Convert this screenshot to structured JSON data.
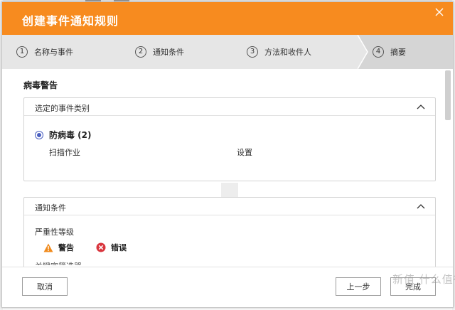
{
  "dialog": {
    "title": "创建事件通知规则"
  },
  "steps": [
    {
      "num": "1",
      "label": "名称与事件"
    },
    {
      "num": "2",
      "label": "通知条件"
    },
    {
      "num": "3",
      "label": "方法和收件人"
    },
    {
      "num": "4",
      "label": "摘要"
    }
  ],
  "summary": {
    "section_title": "病毒警告",
    "event_panel": {
      "header": "选定的事件类别",
      "selected_event": "防病毒 (2)",
      "items": [
        "扫描作业",
        "设置"
      ]
    },
    "condition_panel": {
      "header": "通知条件",
      "severity_label": "严重性等级",
      "severities": [
        {
          "label": "警告",
          "icon": "warning-icon",
          "color": "#f08a1c"
        },
        {
          "label": "错误",
          "icon": "error-icon",
          "color": "#d9363e"
        }
      ],
      "cut_off_text": "关键字筛选器"
    }
  },
  "footer": {
    "cancel_label": "取消",
    "prev_label": "上一步",
    "done_label": "完成"
  },
  "watermark": "新值 什么值得买",
  "colors": {
    "accent": "#f78b1f",
    "radio": "#4a5fbf"
  }
}
